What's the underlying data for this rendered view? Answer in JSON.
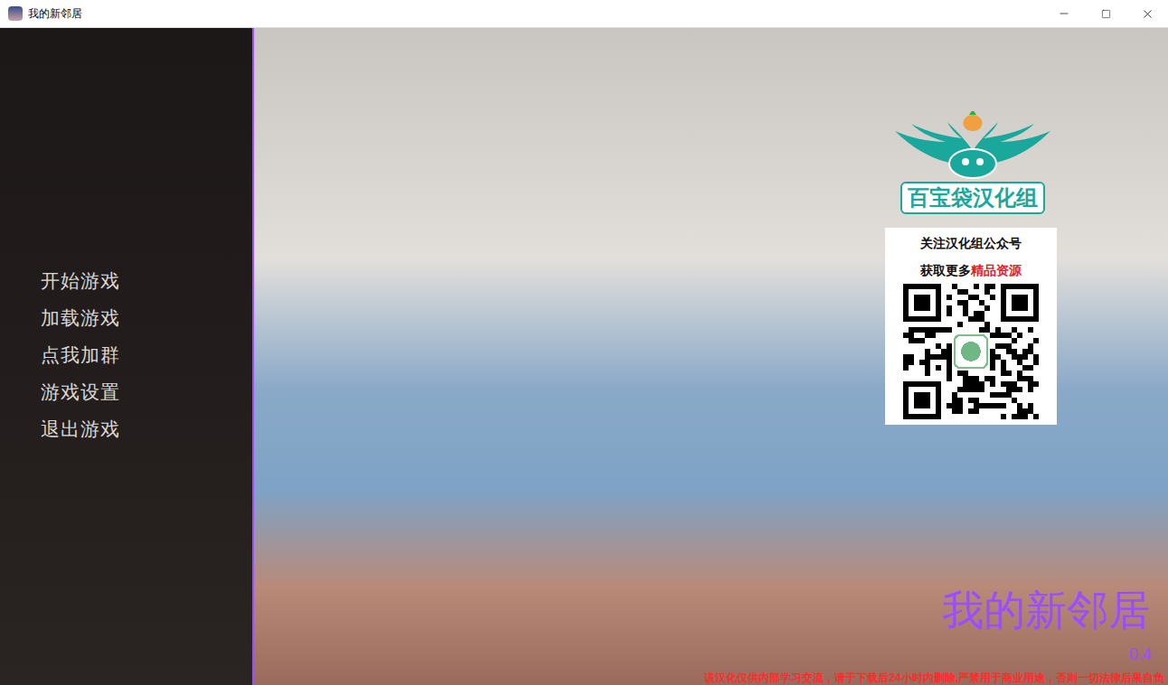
{
  "window": {
    "title": "我的新邻居"
  },
  "menu": {
    "items": [
      {
        "label": "开始游戏"
      },
      {
        "label": "加载游戏"
      },
      {
        "label": "点我加群"
      },
      {
        "label": "游戏设置"
      },
      {
        "label": "退出游戏"
      }
    ]
  },
  "watermark": {
    "group": "百宝袋汉化组",
    "line1": "关注汉化组公众号",
    "line2": [
      {
        "text": "获取更多",
        "color": "#111111"
      },
      {
        "text": "精品资源",
        "color": "#e0202a"
      }
    ]
  },
  "title": {
    "text": "我的新邻居",
    "version": "0.4"
  },
  "disclaimer": "该汉化仅供内部学习交流，请于下载后24小时内删除,严禁用于商业用途，否则一切法律后果自负"
}
